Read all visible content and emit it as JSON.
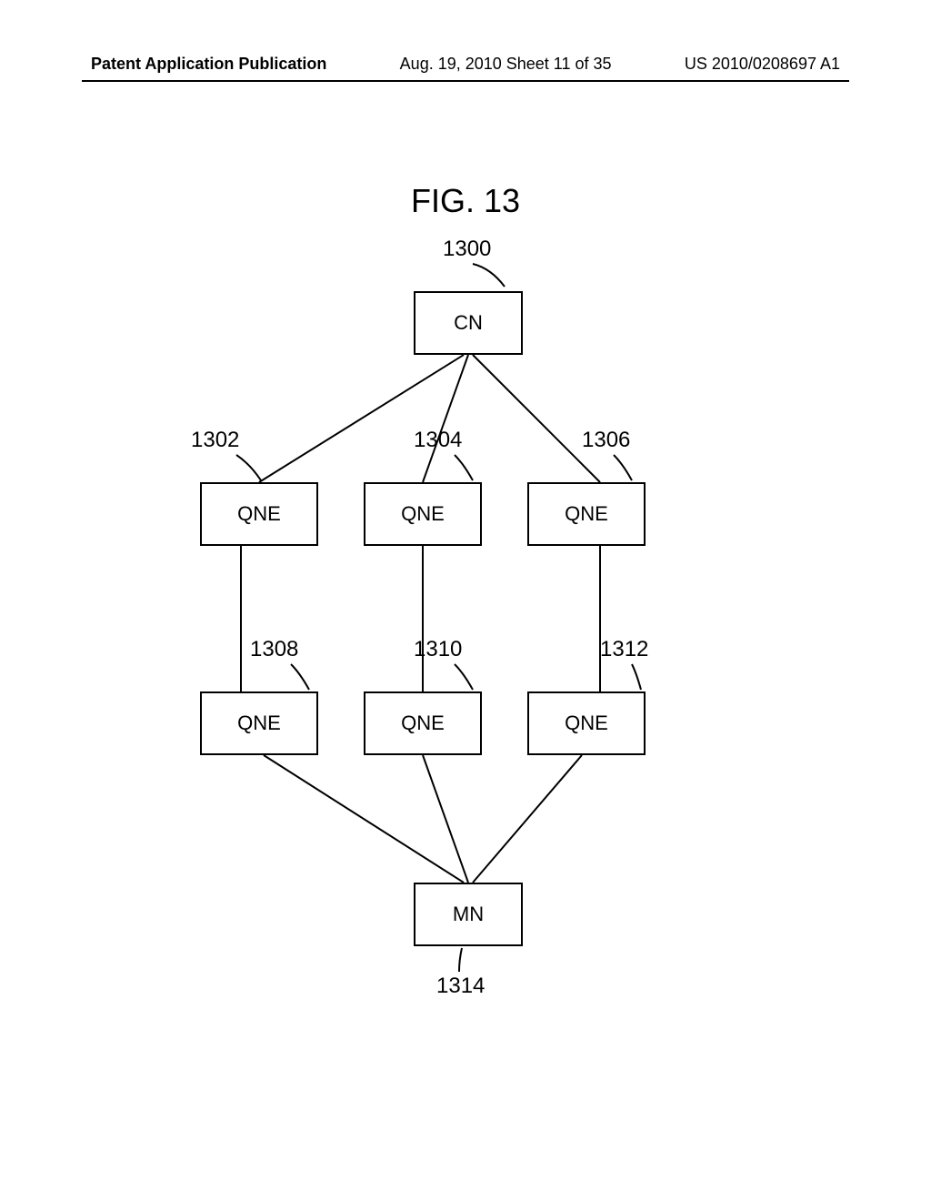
{
  "header": {
    "left": "Patent Application Publication",
    "center": "Aug. 19, 2010  Sheet 11 of 35",
    "right": "US 2010/0208697 A1"
  },
  "figure_title": "FIG. 13",
  "nodes": {
    "cn": {
      "label": "CN",
      "ref": "1300"
    },
    "qne1": {
      "label": "QNE",
      "ref": "1302"
    },
    "qne2": {
      "label": "QNE",
      "ref": "1304"
    },
    "qne3": {
      "label": "QNE",
      "ref": "1306"
    },
    "qne4": {
      "label": "QNE",
      "ref": "1308"
    },
    "qne5": {
      "label": "QNE",
      "ref": "1310"
    },
    "qne6": {
      "label": "QNE",
      "ref": "1312"
    },
    "mn": {
      "label": "MN",
      "ref": "1314"
    }
  },
  "chart_data": {
    "type": "diagram",
    "description": "Network topology diagram showing a CN (correspondent node) at top connected to three QNE nodes in middle-upper row, each connected vertically to a QNE in middle-lower row, all converging to MN (mobile node) at bottom",
    "nodes": [
      {
        "id": "1300",
        "label": "CN",
        "row": 0
      },
      {
        "id": "1302",
        "label": "QNE",
        "row": 1
      },
      {
        "id": "1304",
        "label": "QNE",
        "row": 1
      },
      {
        "id": "1306",
        "label": "QNE",
        "row": 1
      },
      {
        "id": "1308",
        "label": "QNE",
        "row": 2
      },
      {
        "id": "1310",
        "label": "QNE",
        "row": 2
      },
      {
        "id": "1312",
        "label": "QNE",
        "row": 2
      },
      {
        "id": "1314",
        "label": "MN",
        "row": 3
      }
    ],
    "edges": [
      [
        "1300",
        "1302"
      ],
      [
        "1300",
        "1304"
      ],
      [
        "1300",
        "1306"
      ],
      [
        "1302",
        "1308"
      ],
      [
        "1304",
        "1310"
      ],
      [
        "1306",
        "1312"
      ],
      [
        "1308",
        "1314"
      ],
      [
        "1310",
        "1314"
      ],
      [
        "1312",
        "1314"
      ]
    ]
  }
}
